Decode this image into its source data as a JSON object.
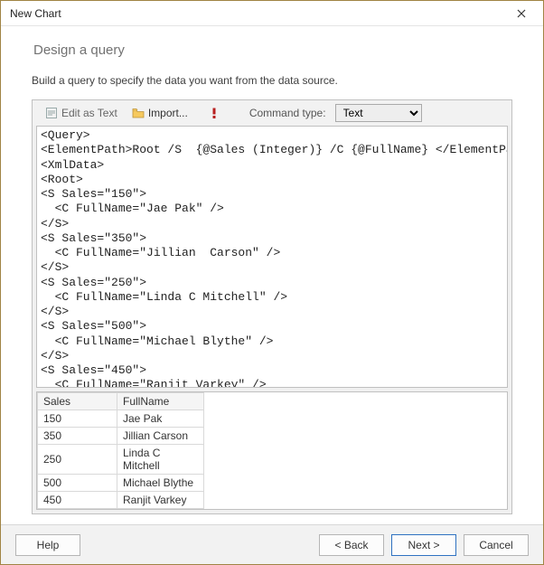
{
  "window": {
    "title": "New Chart"
  },
  "heading": "Design a query",
  "subtext": "Build a query to specify the data you want from the data source.",
  "toolbar": {
    "edit_as_text": "Edit as Text",
    "import": "Import...",
    "command_type_label": "Command type:",
    "command_type_value": "Text"
  },
  "query_text": "<Query>\n<ElementPath>Root /S  {@Sales (Integer)} /C {@FullName} </ElementPath>\n<XmlData>\n<Root>\n<S Sales=\"150\">\n  <C FullName=\"Jae Pak\" />\n</S>\n<S Sales=\"350\">\n  <C FullName=\"Jillian  Carson\" />\n</S>\n<S Sales=\"250\">\n  <C FullName=\"Linda C Mitchell\" />\n</S>\n<S Sales=\"500\">\n  <C FullName=\"Michael Blythe\" />\n</S>\n<S Sales=\"450\">\n  <C FullName=\"Ranjit Varkey\" />\n</S>\n</Root>\n</XmlData>\n</Query>",
  "grid": {
    "columns": [
      "Sales",
      "FullName"
    ],
    "rows": [
      {
        "Sales": "150",
        "FullName": "Jae Pak"
      },
      {
        "Sales": "350",
        "FullName": "Jillian  Carson"
      },
      {
        "Sales": "250",
        "FullName": "Linda C Mitchell"
      },
      {
        "Sales": "500",
        "FullName": "Michael Blythe"
      },
      {
        "Sales": "450",
        "FullName": "Ranjit Varkey"
      }
    ]
  },
  "buttons": {
    "help": "Help",
    "back": "< Back",
    "next": "Next >",
    "cancel": "Cancel"
  }
}
